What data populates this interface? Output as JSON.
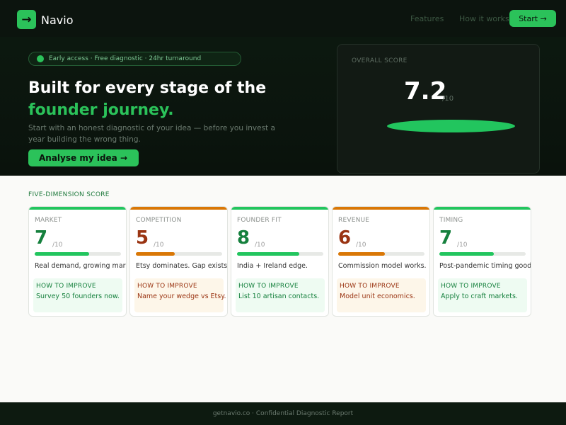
{
  "brand": {
    "name": "Navio",
    "logo_icon": "arrow-right-icon",
    "accent": "#2bc25a"
  },
  "nav": {
    "links": [
      {
        "label": "Features"
      },
      {
        "label": "How it works"
      }
    ],
    "cta_label": "Start →"
  },
  "hero": {
    "badge": "Early access · Free diagnostic · 24hr turnaround",
    "title_line1": "Built for every stage of the",
    "title_line2": "founder journey.",
    "subtitle": "Start with an honest diagnostic of your idea — before you invest a year building the wrong thing.",
    "button": "Analyse my idea →"
  },
  "overall": {
    "label": "OVERALL SCORE",
    "value": "7.2",
    "denom": "/10",
    "fraction": 0.72
  },
  "dimensions": {
    "title": "FIVE-DIMENSION SCORE",
    "cards": [
      {
        "label": "MARKET",
        "score": "7",
        "denom": "/10",
        "fill": 0.7,
        "tone": "green",
        "desc": "Real demand, growing market.",
        "improve_head": "HOW TO IMPROVE",
        "improve_body": "Survey 50 founders now."
      },
      {
        "label": "COMPETITION",
        "score": "5",
        "denom": "/10",
        "fill": 0.5,
        "tone": "orange",
        "desc": "Etsy dominates. Gap exists.",
        "improve_head": "HOW TO IMPROVE",
        "improve_body": "Name your wedge vs Etsy."
      },
      {
        "label": "FOUNDER FIT",
        "score": "8",
        "denom": "/10",
        "fill": 0.8,
        "tone": "green",
        "desc": "India + Ireland edge.",
        "improve_head": "HOW TO IMPROVE",
        "improve_body": "List 10 artisan contacts."
      },
      {
        "label": "REVENUE",
        "score": "6",
        "denom": "/10",
        "fill": 0.6,
        "tone": "orange",
        "desc": "Commission model works.",
        "improve_head": "HOW TO IMPROVE",
        "improve_body": "Model unit economics."
      },
      {
        "label": "TIMING",
        "score": "7",
        "denom": "/10",
        "fill": 0.7,
        "tone": "green",
        "desc": "Post-pandemic timing good.",
        "improve_head": "HOW TO IMPROVE",
        "improve_body": "Apply to craft markets."
      }
    ]
  },
  "footer": {
    "text": "getnavio.co · Confidential Diagnostic Report"
  }
}
